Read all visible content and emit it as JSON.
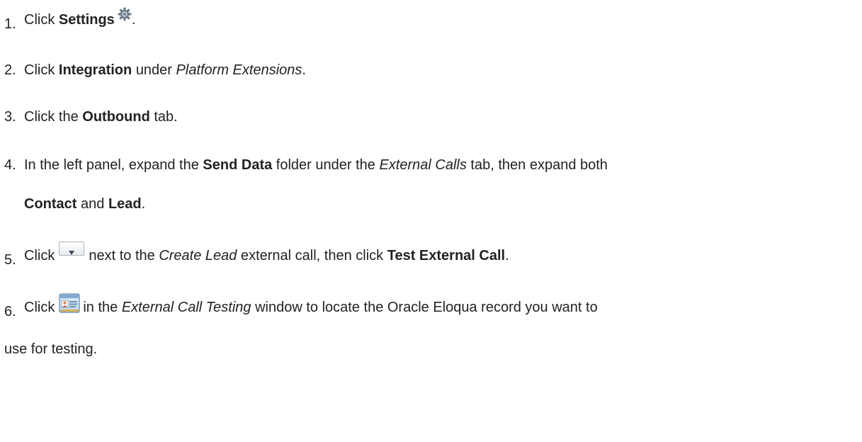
{
  "steps": [
    {
      "number": "1.",
      "click": "Click",
      "settings": "Settings",
      "gear_icon": "gear-icon",
      "period": "."
    },
    {
      "number": "2.",
      "click": "Click",
      "integration": "Integration",
      "under": "under",
      "platform_extensions": "Platform Extensions",
      "period": "."
    },
    {
      "number": "3.",
      "click_the": "Click the",
      "outbound": "Outbound",
      "tab": "tab."
    },
    {
      "number": "4.",
      "line1_prefix": "In the left panel, expand the",
      "send_data": "Send Data",
      "folder_under": "folder under the",
      "external_calls": "External Calls",
      "tab_then": "tab, then expand both",
      "contact": "Contact",
      "and": "and",
      "lead": "Lead",
      "period": "."
    },
    {
      "number": "5.",
      "click": "Click",
      "dropdown_icon": "dropdown-arrow-icon",
      "next_to": "next to the",
      "create_lead": "Create Lead",
      "external_call_then": "external call, then click",
      "test_external_call": "Test External Call",
      "period": "."
    },
    {
      "number": "6.",
      "click": "Click",
      "card_icon": "contact-card-icon",
      "in_the": "in the",
      "external_call_testing": "External Call Testing",
      "window_text": "window to locate the Oracle Eloqua record you want to",
      "line2": "use for testing."
    }
  ]
}
